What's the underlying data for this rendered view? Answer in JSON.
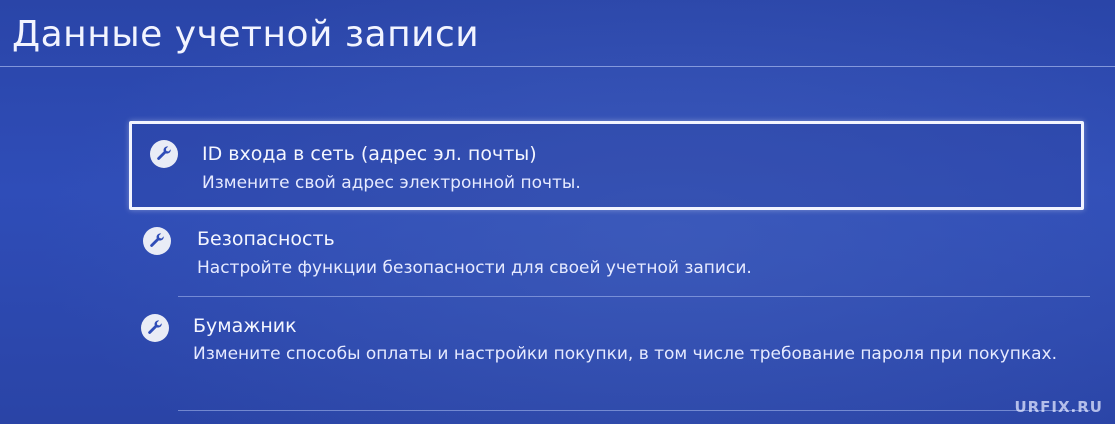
{
  "header": {
    "title": "Данные учетной записи"
  },
  "menu": {
    "items": [
      {
        "icon": "wrench-icon",
        "title": "ID входа в сеть (адрес эл. почты)",
        "description": "Измените свой адрес электронной почты.",
        "focused": true
      },
      {
        "icon": "wrench-icon",
        "title": "Безопасность",
        "description": "Настройте функции безопасности для своей учетной записи."
      },
      {
        "icon": "wrench-icon",
        "title": "Бумажник",
        "description": "Измените способы оплаты и настройки покупки, в том числе требование пароля при покупках."
      }
    ]
  },
  "watermark": "URFIX.RU",
  "colors": {
    "background": "#2f4db8",
    "text": "#ffffff",
    "focus_border": "#f2f4ff"
  }
}
